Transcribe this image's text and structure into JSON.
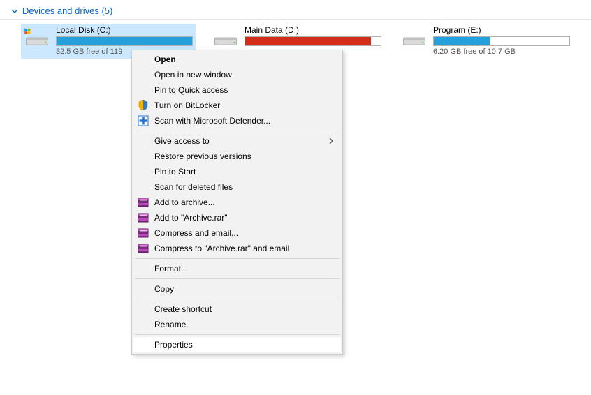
{
  "section": {
    "title": "Devices and drives (5)"
  },
  "drives": [
    {
      "name": "Local Disk (C:)",
      "free_text": "32.5 GB free of 119",
      "fill_pct": 100,
      "fill_color": "#26a0da",
      "selected": true,
      "has_winlogo": true
    },
    {
      "name": "Main Data (D:)",
      "free_text": "",
      "fill_pct": 93,
      "fill_color": "#d62c1a",
      "selected": false,
      "has_winlogo": false
    },
    {
      "name": "Program (E:)",
      "free_text": "6.20 GB free of 10.7 GB",
      "fill_pct": 42,
      "fill_color": "#26a0da",
      "selected": false,
      "has_winlogo": false
    }
  ],
  "menu": {
    "items": [
      {
        "label": "Open",
        "bold": true
      },
      {
        "label": "Open in new window"
      },
      {
        "label": "Pin to Quick access"
      },
      {
        "label": "Turn on BitLocker",
        "icon": "bitlocker"
      },
      {
        "label": "Scan with Microsoft Defender...",
        "icon": "defender"
      },
      {
        "sep": true
      },
      {
        "label": "Give access to",
        "arrow": true
      },
      {
        "label": "Restore previous versions"
      },
      {
        "label": "Pin to Start"
      },
      {
        "label": "Scan for deleted files"
      },
      {
        "label": "Add to archive...",
        "icon": "rar"
      },
      {
        "label": "Add to \"Archive.rar\"",
        "icon": "rar"
      },
      {
        "label": "Compress and email...",
        "icon": "rar"
      },
      {
        "label": "Compress to \"Archive.rar\" and email",
        "icon": "rar"
      },
      {
        "sep": true
      },
      {
        "label": "Format..."
      },
      {
        "sep": true
      },
      {
        "label": "Copy"
      },
      {
        "sep": true
      },
      {
        "label": "Create shortcut"
      },
      {
        "label": "Rename"
      },
      {
        "sep": true
      },
      {
        "label": "Properties",
        "hl": true
      }
    ]
  }
}
